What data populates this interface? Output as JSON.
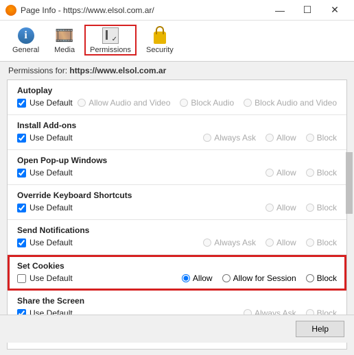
{
  "window": {
    "title": "Page Info - https://www.elsol.com.ar/",
    "url": "https://www.elsol.com.ar"
  },
  "toolbar": {
    "general": "General",
    "media": "Media",
    "permissions": "Permissions",
    "security": "Security"
  },
  "subheader": {
    "prefix": "Permissions for:  ",
    "url": "https://www.elsol.com.ar"
  },
  "sections": {
    "autoplay": {
      "title": "Autoplay",
      "use_default": "Use Default",
      "opt_av": "Allow Audio and Video",
      "opt_ba": "Block Audio",
      "opt_bav": "Block Audio and Video"
    },
    "addons": {
      "title": "Install Add-ons",
      "use_default": "Use Default",
      "opt_ask": "Always Ask",
      "opt_allow": "Allow",
      "opt_block": "Block"
    },
    "popups": {
      "title": "Open Pop-up Windows",
      "use_default": "Use Default",
      "opt_allow": "Allow",
      "opt_block": "Block"
    },
    "keyboard": {
      "title": "Override Keyboard Shortcuts",
      "use_default": "Use Default",
      "opt_allow": "Allow",
      "opt_block": "Block"
    },
    "notifications": {
      "title": "Send Notifications",
      "use_default": "Use Default",
      "opt_ask": "Always Ask",
      "opt_allow": "Allow",
      "opt_block": "Block"
    },
    "cookies": {
      "title": "Set Cookies",
      "use_default": "Use Default",
      "opt_allow": "Allow",
      "opt_session": "Allow for Session",
      "opt_block": "Block"
    },
    "screen": {
      "title": "Share the Screen",
      "use_default": "Use Default",
      "opt_ask": "Always Ask",
      "opt_block": "Block"
    }
  },
  "footer": {
    "help": "Help"
  }
}
